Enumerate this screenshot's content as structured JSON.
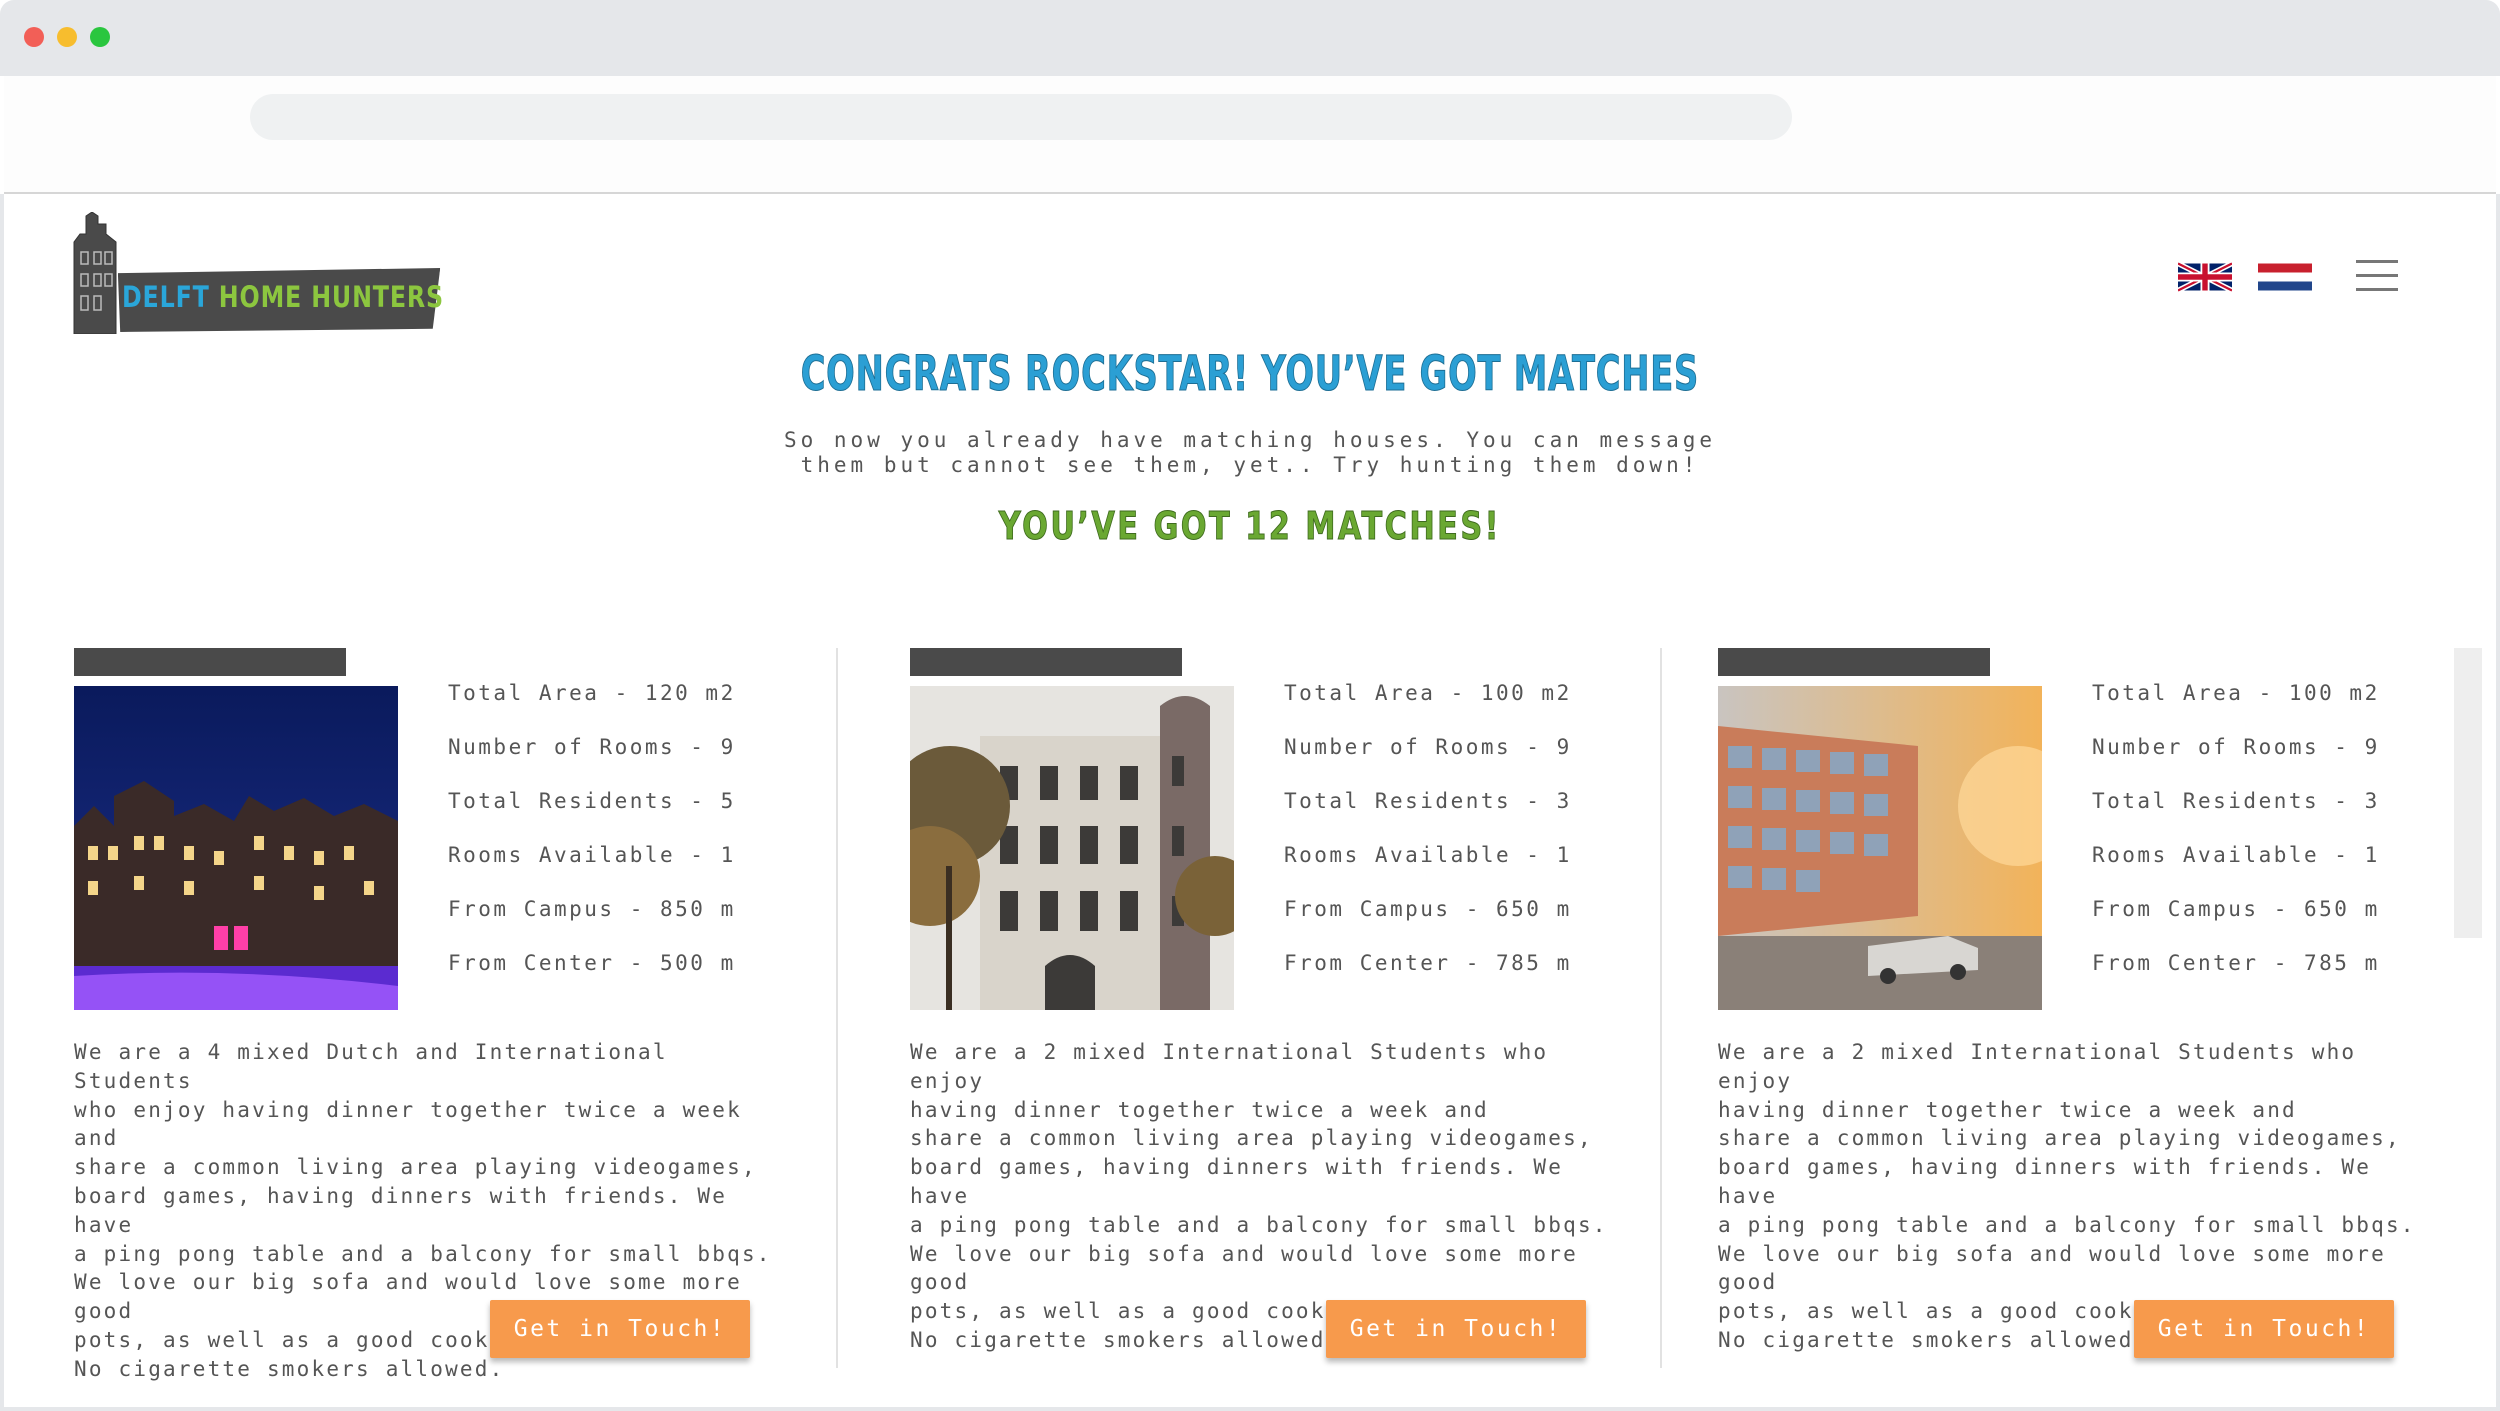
{
  "header": {
    "logo_text_part1": "DELFT",
    "logo_text_part2": "HOME HUNTERS",
    "colors": {
      "logo_blue": "#2aa6d9",
      "logo_green": "#8cc63f",
      "accent": "#f79a4c"
    }
  },
  "hero": {
    "title": "CONGRATS ROCKSTAR! YOU’VE GOT MATCHES",
    "subtitle_line1": "So now you already have matching houses. You can message",
    "subtitle_line2": "them but cannot see them, yet.. Try hunting them down!",
    "matches": "YOU’VE GOT 12 MATCHES!"
  },
  "cards": [
    {
      "stats": [
        "Total Area - 120 m2",
        "Number of Rooms - 9",
        "Total Residents - 5",
        "Rooms Available - 1",
        "From Campus - 850 m",
        "From Center - 500 m"
      ],
      "description": "We are a 4 mixed Dutch and International Students\nwho enjoy having dinner together twice a week and\nshare a common living area playing videogames,\nboard games, having dinners with friends. We have\na ping pong table and a balcony for small bbqs.\nWe love our big sofa and would love some more good\npots, as well as a good cook for a roomie :)\nNo cigarette smokers allowed.",
      "cta": "Get in Touch!"
    },
    {
      "stats": [
        "Total Area - 100 m2",
        "Number of Rooms - 9",
        "Total Residents - 3",
        "Rooms Available - 1",
        "From Campus - 650 m",
        "From Center - 785 m"
      ],
      "description": "We are a 2 mixed International Students who enjoy\nhaving dinner together twice a week and\nshare a common living area playing videogames,\nboard games, having dinners with friends. We have\na ping pong table and a balcony for small bbqs.\nWe love our big sofa and would love some more good\npots, as well as a good cook for a roomie :)\nNo cigarette smokers allowed.",
      "cta": "Get in Touch!"
    },
    {
      "stats": [
        "Total Area - 100 m2",
        "Number of Rooms - 9",
        "Total Residents - 3",
        "Rooms Available - 1",
        "From Campus - 650 m",
        "From Center - 785 m"
      ],
      "description": "We are a 2 mixed International Students who enjoy\nhaving dinner together twice a week and\nshare a common living area playing videogames,\nboard games, having dinners with friends. We have\na ping pong table and a balcony for small bbqs.\nWe love our big sofa and would love some more good\npots, as well as a good cook for a roomie :)\nNo cigarette smokers allowed.",
      "cta": "Get in Touch!"
    }
  ]
}
